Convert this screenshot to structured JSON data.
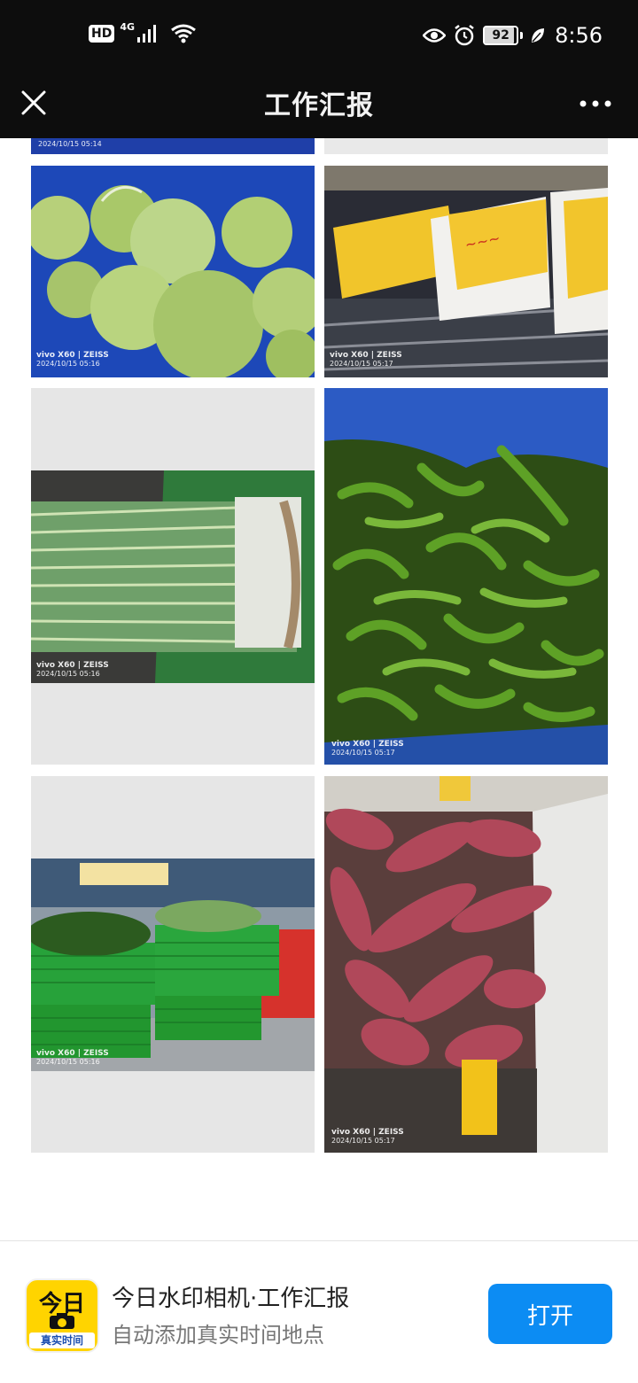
{
  "status_bar": {
    "hd": "HD",
    "network": "4G",
    "battery": "92",
    "battery_level": 0.92,
    "time": "8:56"
  },
  "title_bar": {
    "title": "工作汇报",
    "close_icon": "close-icon",
    "more_icon": "more-dots-icon"
  },
  "photos": [
    {
      "subject": "partial-top-left",
      "brand": "",
      "timestamp": "2024/10/15 05:14"
    },
    {
      "subject": "cabbage",
      "brand": "vivo X60 | ZEISS",
      "timestamp": "2024/10/15 05:16"
    },
    {
      "subject": "bagged-vegetables",
      "brand": "vivo X60 | ZEISS",
      "timestamp": "2024/10/15 05:17"
    },
    {
      "subject": "green-onions",
      "brand": "vivo X60 | ZEISS",
      "timestamp": "2024/10/15 05:16"
    },
    {
      "subject": "green-chili-peppers",
      "brand": "vivo X60 | ZEISS",
      "timestamp": "2024/10/15 05:17"
    },
    {
      "subject": "vegetable-baskets",
      "brand": "vivo X60 | ZEISS",
      "timestamp": "2024/10/15 05:16"
    },
    {
      "subject": "sweet-potatoes",
      "brand": "vivo X60 | ZEISS",
      "timestamp": "2024/10/15 05:17"
    }
  ],
  "banner": {
    "app_icon_top": "今日",
    "app_icon_bottom": "真实时间",
    "app_name": "今日水印相机·工作汇报",
    "app_desc": "自动添加真实时间地点",
    "open_label": "打开"
  }
}
